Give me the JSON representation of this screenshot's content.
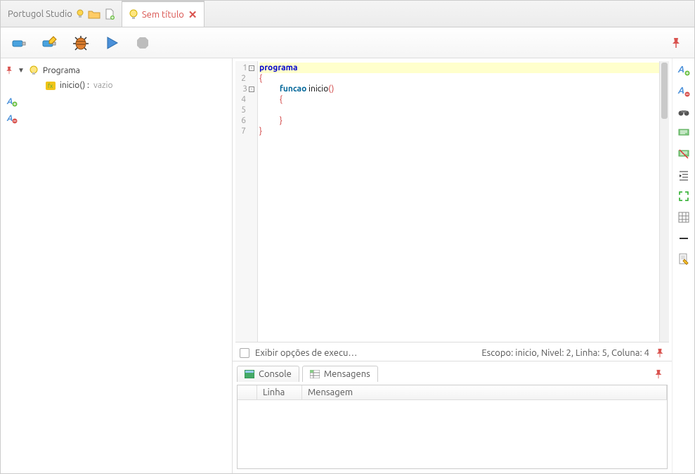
{
  "tabs": {
    "app": "Portugol Studio",
    "file": "Sem título"
  },
  "tree": {
    "root": "Programa",
    "child": "inicio() :",
    "childType": "vazio"
  },
  "editor": {
    "lines": [
      "1",
      "2",
      "3",
      "4",
      "5",
      "6",
      "7"
    ]
  },
  "status": {
    "checkboxLabel": "Exibir opções de execu…",
    "scope": "Escopo: inicio, Nivel: 2, Linha: 5, Coluna: 4"
  },
  "bottomTabs": {
    "console": "Console",
    "messages": "Mensagens"
  },
  "msgHeaders": {
    "linha": "Linha",
    "mensagem": "Mensagem"
  },
  "code": {
    "l1": "programa",
    "l2": "{",
    "l3a": "funcao",
    "l3b": " inicio",
    "l3c": "()",
    "l4": "{",
    "l6": "}",
    "l7": "}"
  }
}
